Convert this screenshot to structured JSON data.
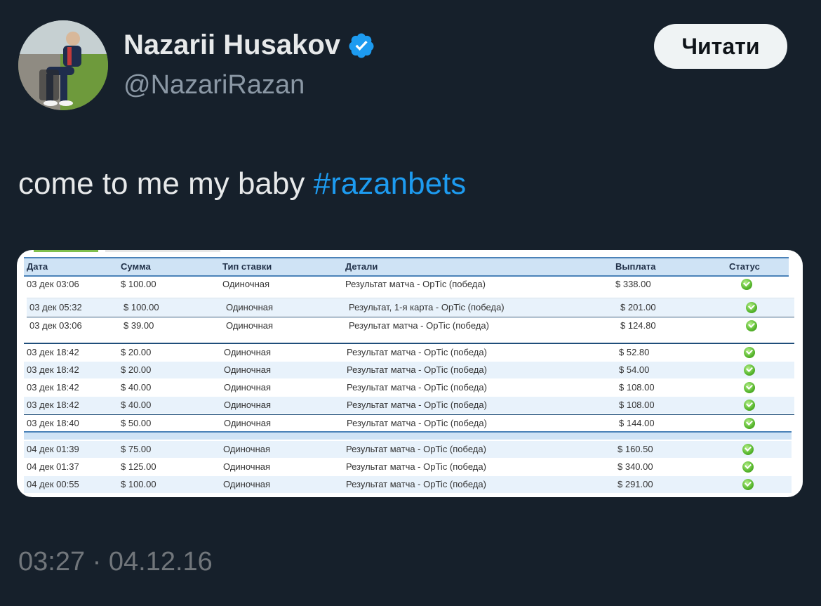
{
  "author": {
    "name": "Nazarii Husakov",
    "handle": "@NazariRazan",
    "verified_icon": "verified-badge-icon"
  },
  "follow_button": {
    "label": "Читати"
  },
  "tweet": {
    "text": "come to me my baby ",
    "hashtag": "#razanbets",
    "timestamp": "03:27 · 04.12.16"
  },
  "colors": {
    "background": "#16202b",
    "hashtag": "#1d9bf0",
    "check": "#56b62c"
  },
  "bets_table": {
    "columns": [
      "Дата",
      "Сумма",
      "Тип ставки",
      "Детали",
      "Выплата",
      "Статус"
    ],
    "block1": [
      {
        "date": "03 дек 03:06",
        "amount": "$ 100.00",
        "type": "Одиночная",
        "details": "Результат матча - OpTic (победа)",
        "payout": "$ 338.00",
        "status": "win"
      }
    ],
    "block2": [
      {
        "date": "03 дек 05:32",
        "amount": "$ 100.00",
        "type": "Одиночная",
        "details": "Результат, 1-я карта - OpTic (победа)",
        "payout": "$ 201.00",
        "status": "win"
      },
      {
        "date": "03 дек 03:06",
        "amount": "$ 39.00",
        "type": "Одиночная",
        "details": "Результат матча - OpTic (победа)",
        "payout": "$ 124.80",
        "status": "win"
      }
    ],
    "block3": [
      {
        "date": "03 дек 18:42",
        "amount": "$ 20.00",
        "type": "Одиночная",
        "details": "Результат матча - OpTic (победа)",
        "payout": "$ 52.80",
        "status": "win"
      },
      {
        "date": "03 дек 18:42",
        "amount": "$ 20.00",
        "type": "Одиночная",
        "details": "Результат матча - OpTic (победа)",
        "payout": "$ 54.00",
        "status": "win"
      },
      {
        "date": "03 дек 18:42",
        "amount": "$ 40.00",
        "type": "Одиночная",
        "details": "Результат матча - OpTic (победа)",
        "payout": "$ 108.00",
        "status": "win"
      },
      {
        "date": "03 дек 18:42",
        "amount": "$ 40.00",
        "type": "Одиночная",
        "details": "Результат матча - OpTic (победа)",
        "payout": "$ 108.00",
        "status": "win"
      },
      {
        "date": "03 дек 18:40",
        "amount": "$ 50.00",
        "type": "Одиночная",
        "details": "Результат матча - OpTic (победа)",
        "payout": "$ 144.00",
        "status": "win"
      }
    ],
    "block4": [
      {
        "date": "04 дек 01:39",
        "amount": "$ 75.00",
        "type": "Одиночная",
        "details": "Результат матча - OpTic (победа)",
        "payout": "$ 160.50",
        "status": "win"
      },
      {
        "date": "04 дек 01:37",
        "amount": "$ 125.00",
        "type": "Одиночная",
        "details": "Результат матча - OpTic (победа)",
        "payout": "$ 340.00",
        "status": "win"
      },
      {
        "date": "04 дек 00:55",
        "amount": "$ 100.00",
        "type": "Одиночная",
        "details": "Результат матча - OpTic (победа)",
        "payout": "$ 291.00",
        "status": "win"
      }
    ]
  }
}
